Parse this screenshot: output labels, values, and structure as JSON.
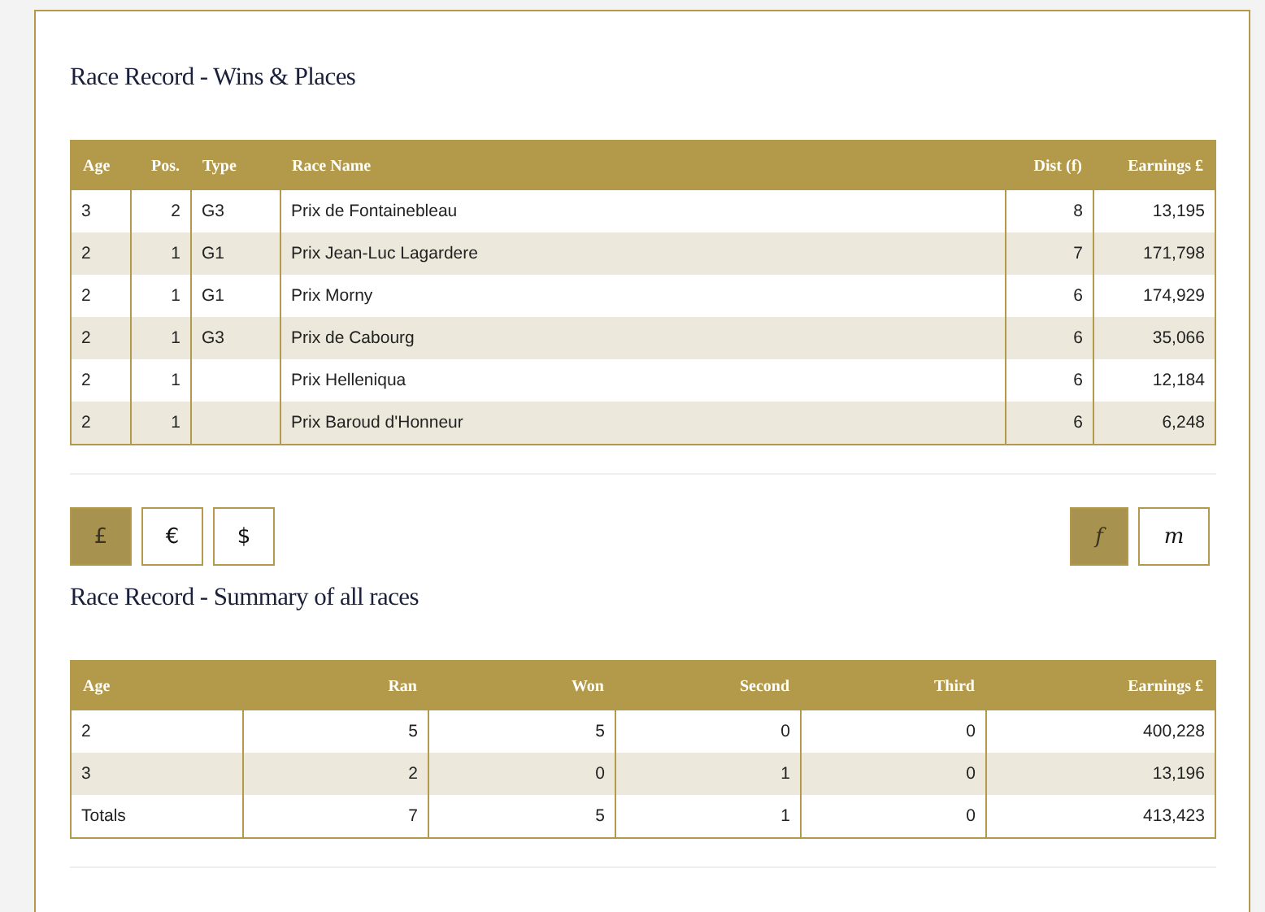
{
  "wins_places": {
    "title": "Race Record - Wins & Places",
    "columns": [
      "Age",
      "Pos.",
      "Type",
      "Race Name",
      "Dist (f)",
      "Earnings £"
    ],
    "rows": [
      [
        "3",
        "2",
        "G3",
        "Prix de Fontainebleau",
        "8",
        "13,195"
      ],
      [
        "2",
        "1",
        "G1",
        "Prix Jean-Luc Lagardere",
        "7",
        "171,798"
      ],
      [
        "2",
        "1",
        "G1",
        "Prix Morny",
        "6",
        "174,929"
      ],
      [
        "2",
        "1",
        "G3",
        "Prix de Cabourg",
        "6",
        "35,066"
      ],
      [
        "2",
        "1",
        "",
        "Prix Helleniqua",
        "6",
        "12,184"
      ],
      [
        "2",
        "1",
        "",
        "Prix Baroud d'Honneur",
        "6",
        "6,248"
      ]
    ]
  },
  "currency_buttons": [
    {
      "label": "£",
      "selected": true
    },
    {
      "label": "€",
      "selected": false
    },
    {
      "label": "$",
      "selected": false
    }
  ],
  "distance_buttons": [
    {
      "label": "f",
      "selected": true
    },
    {
      "label": "m",
      "selected": false
    }
  ],
  "summary": {
    "title": "Race Record - Summary of all races",
    "columns": [
      "Age",
      "Ran",
      "Won",
      "Second",
      "Third",
      "Earnings £"
    ],
    "rows": [
      [
        "2",
        "5",
        "5",
        "0",
        "0",
        "400,228"
      ],
      [
        "3",
        "2",
        "0",
        "1",
        "0",
        "13,196"
      ],
      [
        "Totals",
        "7",
        "5",
        "1",
        "0",
        "413,423"
      ]
    ]
  }
}
